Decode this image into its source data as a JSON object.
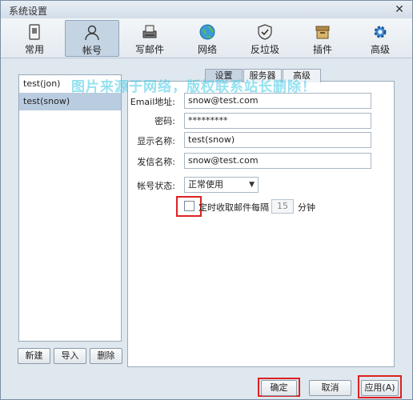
{
  "window": {
    "title": "系统设置",
    "close_glyph": "✕"
  },
  "toolbar": {
    "items": [
      {
        "label": "常用",
        "icon": "general-icon"
      },
      {
        "label": "帐号",
        "icon": "user-icon"
      },
      {
        "label": "写邮件",
        "icon": "compose-icon"
      },
      {
        "label": "网络",
        "icon": "network-icon"
      },
      {
        "label": "反垃圾",
        "icon": "antispam-icon"
      },
      {
        "label": "插件",
        "icon": "plugin-icon"
      },
      {
        "label": "高级",
        "icon": "advanced-icon"
      }
    ],
    "active_index": 1
  },
  "accounts": {
    "items": [
      "test(jon)",
      "test(snow)"
    ],
    "selected_index": 1,
    "buttons": {
      "new": "新建",
      "import": "导入",
      "delete": "删除"
    }
  },
  "tabs": [
    "设置",
    "服务器",
    "高级"
  ],
  "active_tab": 0,
  "form": {
    "email": {
      "label": "Email地址:",
      "value": "snow@test.com"
    },
    "password": {
      "label": "密码:",
      "value": "*********"
    },
    "display_name": {
      "label": "显示名称:",
      "value": "test(snow)"
    },
    "sender_name": {
      "label": "发信名称:",
      "value": "snow@test.com"
    },
    "status": {
      "label": "帐号状态:",
      "value": "正常使用"
    },
    "schedule": {
      "checkbox_label": "定时收取邮件",
      "every": "每隔",
      "interval": "15",
      "unit": "分钟",
      "checked": false
    }
  },
  "watermark": "图片来源于网络，版权联系站长删除！",
  "footer": {
    "ok": "确定",
    "cancel": "取消",
    "apply": "应用(A)"
  },
  "colors": {
    "highlight": "#dd2222",
    "selection": "#b9cce0"
  }
}
